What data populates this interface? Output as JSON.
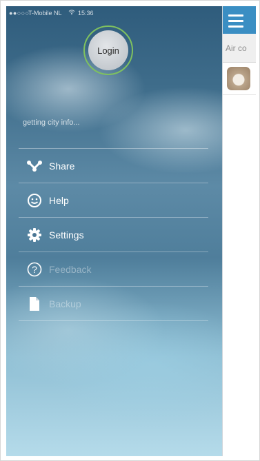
{
  "status_bar": {
    "signal": "●●○○○",
    "carrier": "T-Mobile NL",
    "wifi_icon": "wifi-icon",
    "time": "15:36"
  },
  "drawer": {
    "login_label": "Login",
    "city_info": "getting city info...",
    "menu": [
      {
        "label": "Share",
        "icon": "share-icon",
        "faded": false
      },
      {
        "label": "Help",
        "icon": "smiley-icon",
        "faded": false
      },
      {
        "label": "Settings",
        "icon": "gear-icon",
        "faded": false
      },
      {
        "label": "Feedback",
        "icon": "question-icon",
        "faded": true
      },
      {
        "label": "Backup",
        "icon": "document-icon",
        "faded": true
      }
    ]
  },
  "main": {
    "menu_icon": "hamburger-icon",
    "search_text": "Air co",
    "header_color": "#3a8ec3"
  }
}
